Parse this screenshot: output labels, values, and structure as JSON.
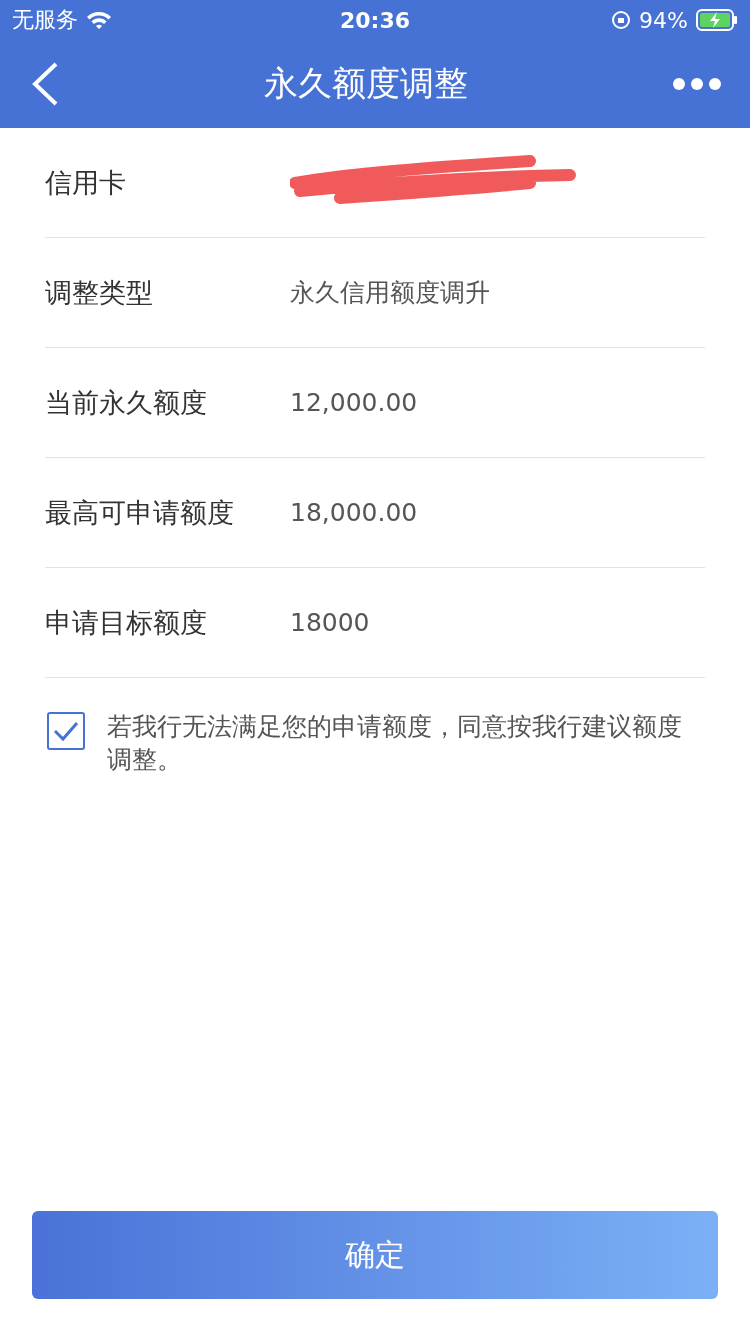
{
  "status_bar": {
    "carrier": "无服务",
    "time": "20:36",
    "battery": "94%"
  },
  "nav": {
    "title": "永久额度调整"
  },
  "rows": [
    {
      "kind": "redacted",
      "label": "信用卡"
    },
    {
      "kind": "text",
      "label": "调整类型",
      "value": "永久信用额度调升"
    },
    {
      "kind": "text",
      "label": "当前永久额度",
      "value": "12,000.00"
    },
    {
      "kind": "text",
      "label": "最高可申请额度",
      "value": "18,000.00"
    },
    {
      "kind": "text",
      "label": "申请目标额度",
      "value": "18000"
    }
  ],
  "agreement": {
    "checked": true,
    "text": "若我行无法满足您的申请额度，同意按我行建议额度调整。"
  },
  "confirm_button": "确定"
}
